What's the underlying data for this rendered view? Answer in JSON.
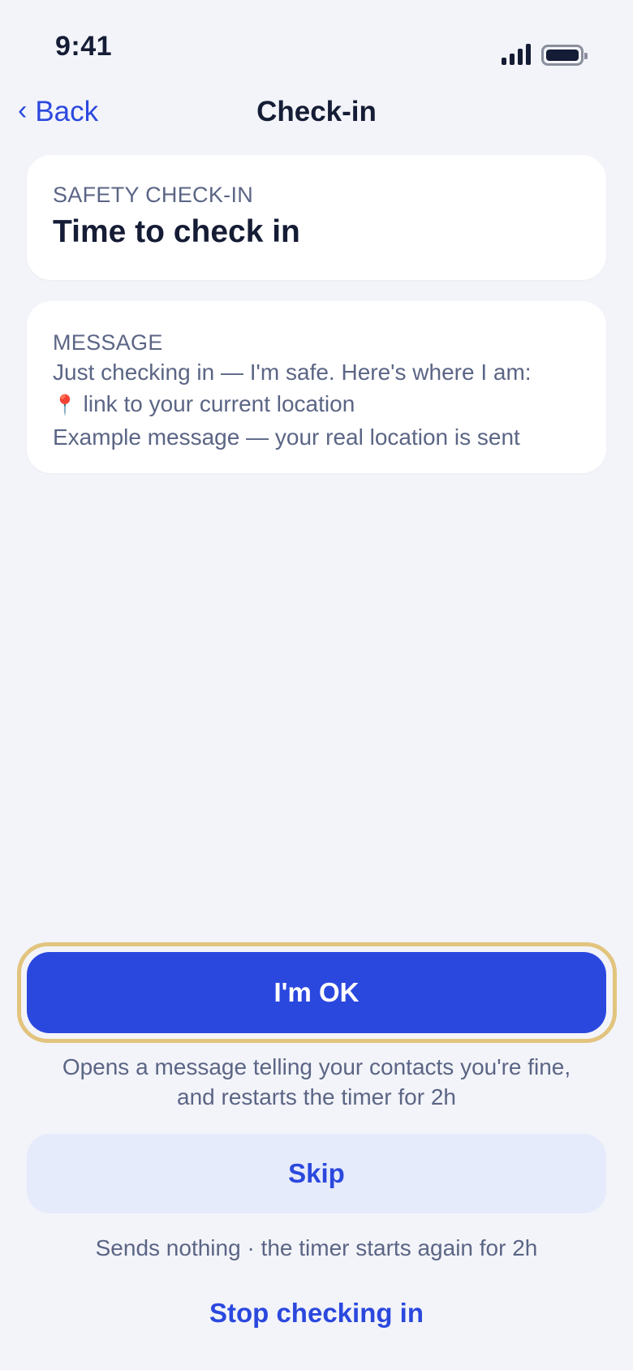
{
  "status_bar": {
    "time": "9:41"
  },
  "nav": {
    "back_label": "Back",
    "title": "Check-in"
  },
  "header_card": {
    "eyebrow": "SAFETY CHECK-IN",
    "title": "Time to check in"
  },
  "message_card": {
    "eyebrow": "MESSAGE",
    "line_1": "Just checking in — I'm safe. Here's where I am:",
    "pin_emoji": "📍",
    "line_2": "link to your current location",
    "line_3": "Example message — your real location is sent"
  },
  "actions": {
    "ok_label": "I'm OK",
    "ok_helper_1": "Opens a message telling your contacts you're fine,",
    "ok_helper_2": "and restarts the timer for 2h",
    "skip_label": "Skip",
    "skip_helper": "Sends nothing · the timer starts again for 2h",
    "stop_label": "Stop checking in"
  },
  "colors": {
    "accent": "#2b48de",
    "focus_ring": "#e2c47f",
    "background": "#f3f4f9",
    "skip_bg": "#e6ebfb"
  }
}
